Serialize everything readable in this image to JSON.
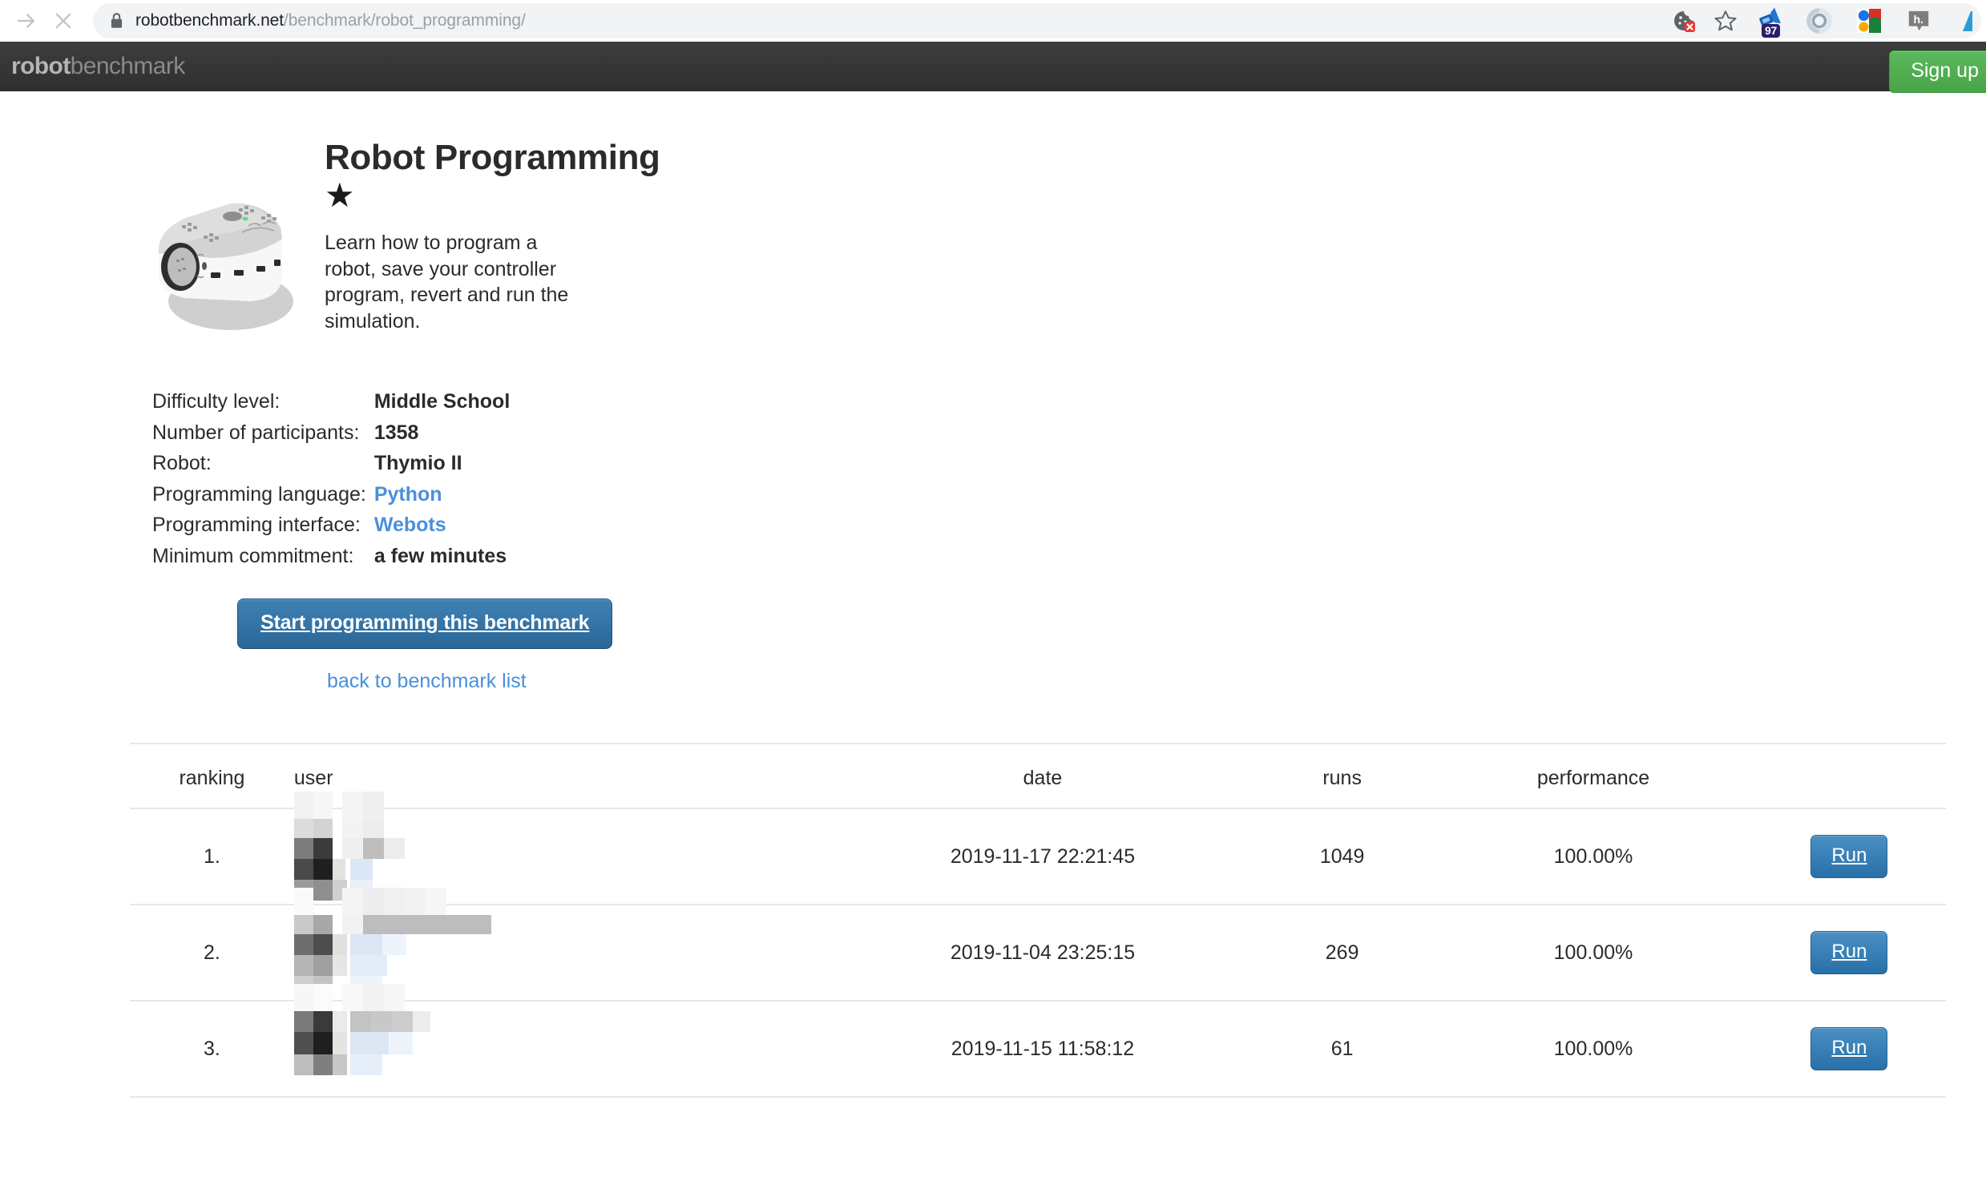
{
  "browser": {
    "nav": {
      "forward_icon": "forward-arrow-icon",
      "stop_icon": "stop-x-icon"
    },
    "omnibox": {
      "lock_icon": "lock-icon",
      "url_host": "robotbenchmark.net",
      "url_path": "/benchmark/robot_programming/",
      "url_full": "robotbenchmark.net/benchmark/robot_programming/"
    },
    "actions": [
      {
        "name": "cookie-blocked-icon",
        "label": ""
      },
      {
        "name": "bookmark-star-icon",
        "label": ""
      }
    ],
    "extensions": [
      {
        "name": "adblock-megaphone-icon",
        "badge": "97"
      },
      {
        "name": "ghostery-icon",
        "badge": ""
      },
      {
        "name": "google-icon",
        "badge": ""
      },
      {
        "name": "hypothesis-icon",
        "badge": ""
      },
      {
        "name": "partial-icon",
        "badge": ""
      }
    ]
  },
  "site_header": {
    "logo_bold": "robot",
    "logo_light": "benchmark",
    "signup_label": "Sign up"
  },
  "benchmark": {
    "robot_image_alt": "thymio-ii-robot-image",
    "title": "Robot Programming",
    "stars": "★",
    "star_count": 1,
    "description": "Learn how to program a robot, save your controller program, revert and run the simulation.",
    "info": [
      {
        "label": "Difficulty level:",
        "value": "Middle School",
        "link": false
      },
      {
        "label": "Number of participants:",
        "value": "1358",
        "link": false
      },
      {
        "label": "Robot:",
        "value": "Thymio II",
        "link": false
      },
      {
        "label": "Programming language:",
        "value": "Python",
        "link": true
      },
      {
        "label": "Programming interface:",
        "value": "Webots",
        "link": true
      },
      {
        "label": "Minimum commitment:",
        "value": "a few minutes",
        "link": false
      }
    ],
    "start_button": "Start programming this benchmark",
    "back_link": "back to benchmark list"
  },
  "ranking_table": {
    "columns": [
      "ranking",
      "user",
      "date",
      "runs",
      "performance",
      ""
    ],
    "rows": [
      {
        "ranking": "1.",
        "user": "",
        "date": "2019-11-17 22:21:45",
        "runs": "1049",
        "performance": "100.00%",
        "action": "Run"
      },
      {
        "ranking": "2.",
        "user": "",
        "date": "2019-11-04 23:25:15",
        "runs": "269",
        "performance": "100.00%",
        "action": "Run"
      },
      {
        "ranking": "3.",
        "user": "",
        "date": "2019-11-15 11:58:12",
        "runs": "61",
        "performance": "100.00%",
        "action": "Run"
      }
    ]
  },
  "colors": {
    "header_bg": "#3a3a3a",
    "signup_green": "#5cb85c",
    "link_blue": "#4a90d9",
    "button_blue": "#2b6698",
    "run_blue": "#2870a8",
    "text": "#2b2b2b",
    "rule": "#e7e7e7"
  }
}
